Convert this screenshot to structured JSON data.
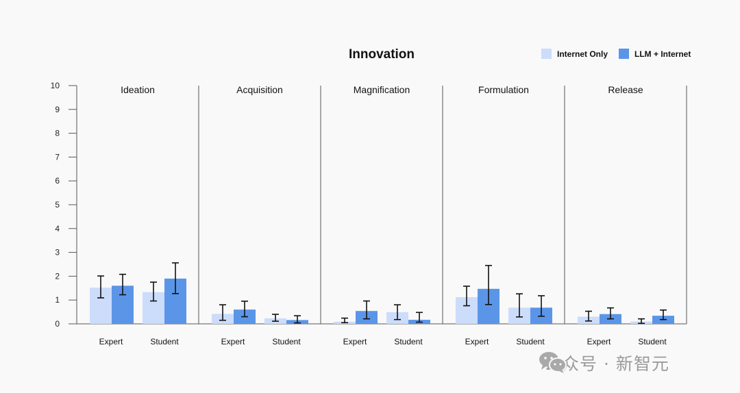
{
  "chart_data": {
    "type": "bar",
    "title": "Innovation",
    "xlabel": "",
    "ylabel": "",
    "ylim": [
      0,
      10
    ],
    "yticks": [
      "0",
      "1",
      "2",
      "3",
      "4",
      "5",
      "6",
      "7",
      "8",
      "9",
      "10"
    ],
    "legend": {
      "placement": "top-right",
      "entries": [
        {
          "name": "Internet Only",
          "color": "#ccdcfb"
        },
        {
          "name": "LLM + Internet",
          "color": "#5b95e8"
        }
      ]
    },
    "groups": [
      "Expert",
      "Student"
    ],
    "panels": [
      {
        "name": "Ideation",
        "series": [
          {
            "name": "Internet Only",
            "values": [
              1.52,
              1.33
            ],
            "err_low": [
              1.09,
              0.96
            ],
            "err_high": [
              2.01,
              1.75
            ]
          },
          {
            "name": "LLM + Internet",
            "values": [
              1.6,
              1.9
            ],
            "err_low": [
              1.22,
              1.27
            ],
            "err_high": [
              2.08,
              2.56
            ]
          }
        ]
      },
      {
        "name": "Acquisition",
        "series": [
          {
            "name": "Internet Only",
            "values": [
              0.42,
              0.23
            ],
            "err_low": [
              0.15,
              0.11
            ],
            "err_high": [
              0.8,
              0.4
            ]
          },
          {
            "name": "LLM + Internet",
            "values": [
              0.6,
              0.16
            ],
            "err_low": [
              0.3,
              0.04
            ],
            "err_high": [
              0.95,
              0.34
            ]
          }
        ]
      },
      {
        "name": "Magnification",
        "series": [
          {
            "name": "Internet Only",
            "values": [
              0.09,
              0.49
            ],
            "err_low": [
              0.05,
              0.18
            ],
            "err_high": [
              0.24,
              0.8
            ]
          },
          {
            "name": "LLM + Internet",
            "values": [
              0.54,
              0.17
            ],
            "err_low": [
              0.21,
              0.07
            ],
            "err_high": [
              0.96,
              0.48
            ]
          }
        ]
      },
      {
        "name": "Formulation",
        "series": [
          {
            "name": "Internet Only",
            "values": [
              1.12,
              0.68
            ],
            "err_low": [
              0.76,
              0.29
            ],
            "err_high": [
              1.58,
              1.26
            ]
          },
          {
            "name": "LLM + Internet",
            "values": [
              1.47,
              0.68
            ],
            "err_low": [
              0.81,
              0.32
            ],
            "err_high": [
              2.45,
              1.18
            ]
          }
        ]
      },
      {
        "name": "Release",
        "series": [
          {
            "name": "Internet Only",
            "values": [
              0.3,
              0.1
            ],
            "err_low": [
              0.12,
              0.02
            ],
            "err_high": [
              0.53,
              0.21
            ]
          },
          {
            "name": "LLM + Internet",
            "values": [
              0.41,
              0.34
            ],
            "err_low": [
              0.21,
              0.18
            ],
            "err_high": [
              0.67,
              0.58
            ]
          }
        ]
      }
    ]
  },
  "watermark": {
    "icon": "wechat-icon",
    "text": "公众号 · 新智元"
  }
}
